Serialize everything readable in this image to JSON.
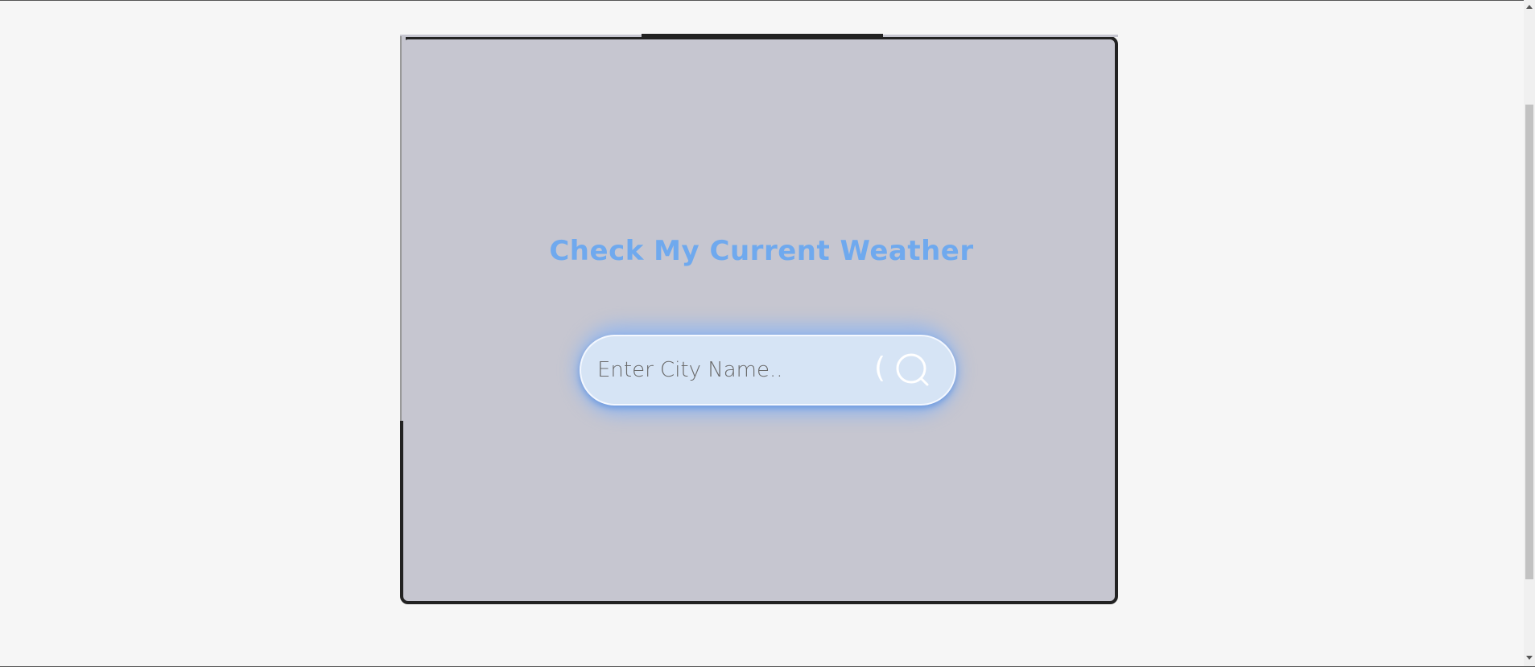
{
  "app": {
    "title": "Check My Current Weather"
  },
  "search": {
    "placeholder": "Enter City Name..",
    "value": ""
  },
  "icons": {
    "search": "search-icon",
    "paren": "("
  },
  "colors": {
    "page_background": "#f6f6f6",
    "card_background": "#c6c6d0",
    "card_border": "#222222",
    "title": "#6fa9ee",
    "search_background": "#d6e4f5",
    "search_glow": "#78afff",
    "icon": "#ffffff"
  }
}
